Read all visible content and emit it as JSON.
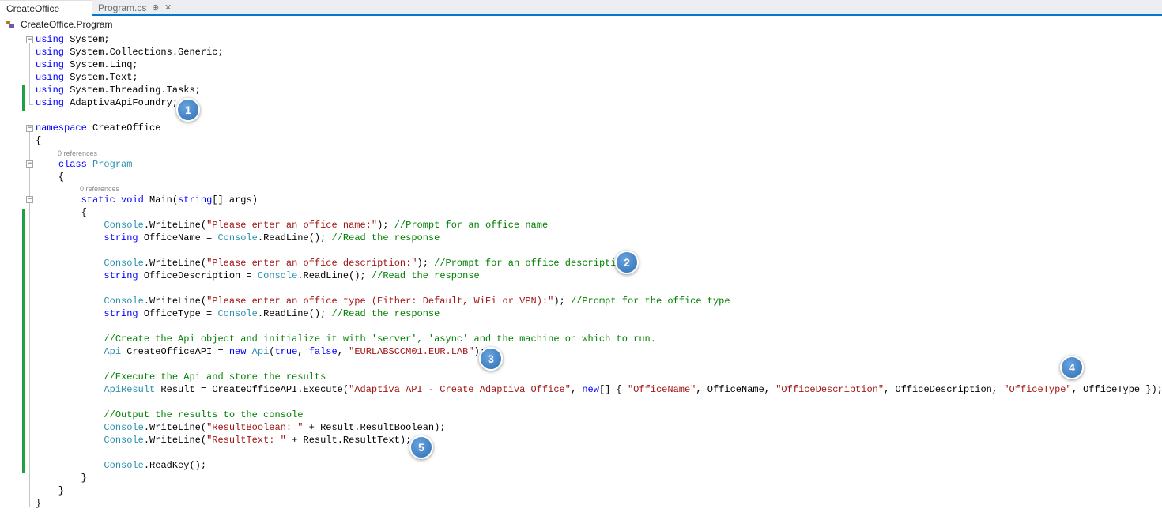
{
  "tabs": [
    {
      "label": "CreateOffice",
      "active": true
    },
    {
      "label": "Program.cs",
      "active": false,
      "pin": "⊕",
      "close": "✕"
    }
  ],
  "nav": {
    "class_path": "CreateOffice.Program"
  },
  "references_label": "0 references",
  "code": {
    "line_1": [
      "using",
      " System;"
    ],
    "line_2": [
      "using",
      " System.Collections.Generic;"
    ],
    "line_3": [
      "using",
      " System.Linq;"
    ],
    "line_4": [
      "using",
      " System.Text;"
    ],
    "line_5": [
      "using",
      " System.Threading.Tasks;"
    ],
    "line_6": [
      "using",
      " AdaptivaApiFoundry;"
    ],
    "line_8": [
      "namespace",
      " CreateOffice"
    ],
    "line_9": "{",
    "line_10": [
      "    ",
      "class",
      " ",
      "Program"
    ],
    "line_11": "    {",
    "line_12": [
      "        ",
      "static",
      " ",
      "void",
      " Main(",
      "string",
      "[] args)"
    ],
    "line_13": "        {",
    "line_14": [
      "            ",
      "Console",
      ".WriteLine(",
      "\"Please enter an office name:\"",
      "); ",
      "//Prompt for an office name"
    ],
    "line_15": [
      "            ",
      "string",
      " OfficeName = ",
      "Console",
      ".ReadLine(); ",
      "//Read the response"
    ],
    "line_17": [
      "            ",
      "Console",
      ".WriteLine(",
      "\"Please enter an office description:\"",
      "); ",
      "//Prompt for an office description"
    ],
    "line_18": [
      "            ",
      "string",
      " OfficeDescription = ",
      "Console",
      ".ReadLine(); ",
      "//Read the response"
    ],
    "line_20": [
      "            ",
      "Console",
      ".WriteLine(",
      "\"Please enter an office type (Either: Default, WiFi or VPN):\"",
      "); ",
      "//Prompt for the office type"
    ],
    "line_21": [
      "            ",
      "string",
      " OfficeType = ",
      "Console",
      ".ReadLine(); ",
      "//Read the response"
    ],
    "line_23": [
      "            ",
      "//Create the Api object and initialize it with 'server', 'async' and the machine on which to run."
    ],
    "line_24": [
      "            ",
      "Api",
      " CreateOfficeAPI = ",
      "new",
      " ",
      "Api",
      "(",
      "true",
      ", ",
      "false",
      ", ",
      "\"EURLABSCCM01.EUR.LAB\"",
      ");"
    ],
    "line_26": [
      "            ",
      "//Execute the Api and store the results"
    ],
    "line_27": [
      "            ",
      "ApiResult",
      " Result = CreateOfficeAPI.Execute(",
      "\"Adaptiva API - Create Adaptiva Office\"",
      ", ",
      "new",
      "[] { ",
      "\"OfficeName\"",
      ", OfficeName, ",
      "\"OfficeDescription\"",
      ", OfficeDescription, ",
      "\"OfficeType\"",
      ", OfficeType });"
    ],
    "line_29": [
      "            ",
      "//Output the results to the console"
    ],
    "line_30": [
      "            ",
      "Console",
      ".WriteLine(",
      "\"ResultBoolean: \"",
      " + Result.ResultBoolean);"
    ],
    "line_31": [
      "            ",
      "Console",
      ".WriteLine(",
      "\"ResultText: \"",
      " + Result.ResultText);"
    ],
    "line_33": [
      "            ",
      "Console",
      ".ReadKey();"
    ],
    "line_34": "        }",
    "line_35": "    }",
    "line_36": "}"
  },
  "callouts": [
    "1",
    "2",
    "3",
    "4",
    "5"
  ]
}
